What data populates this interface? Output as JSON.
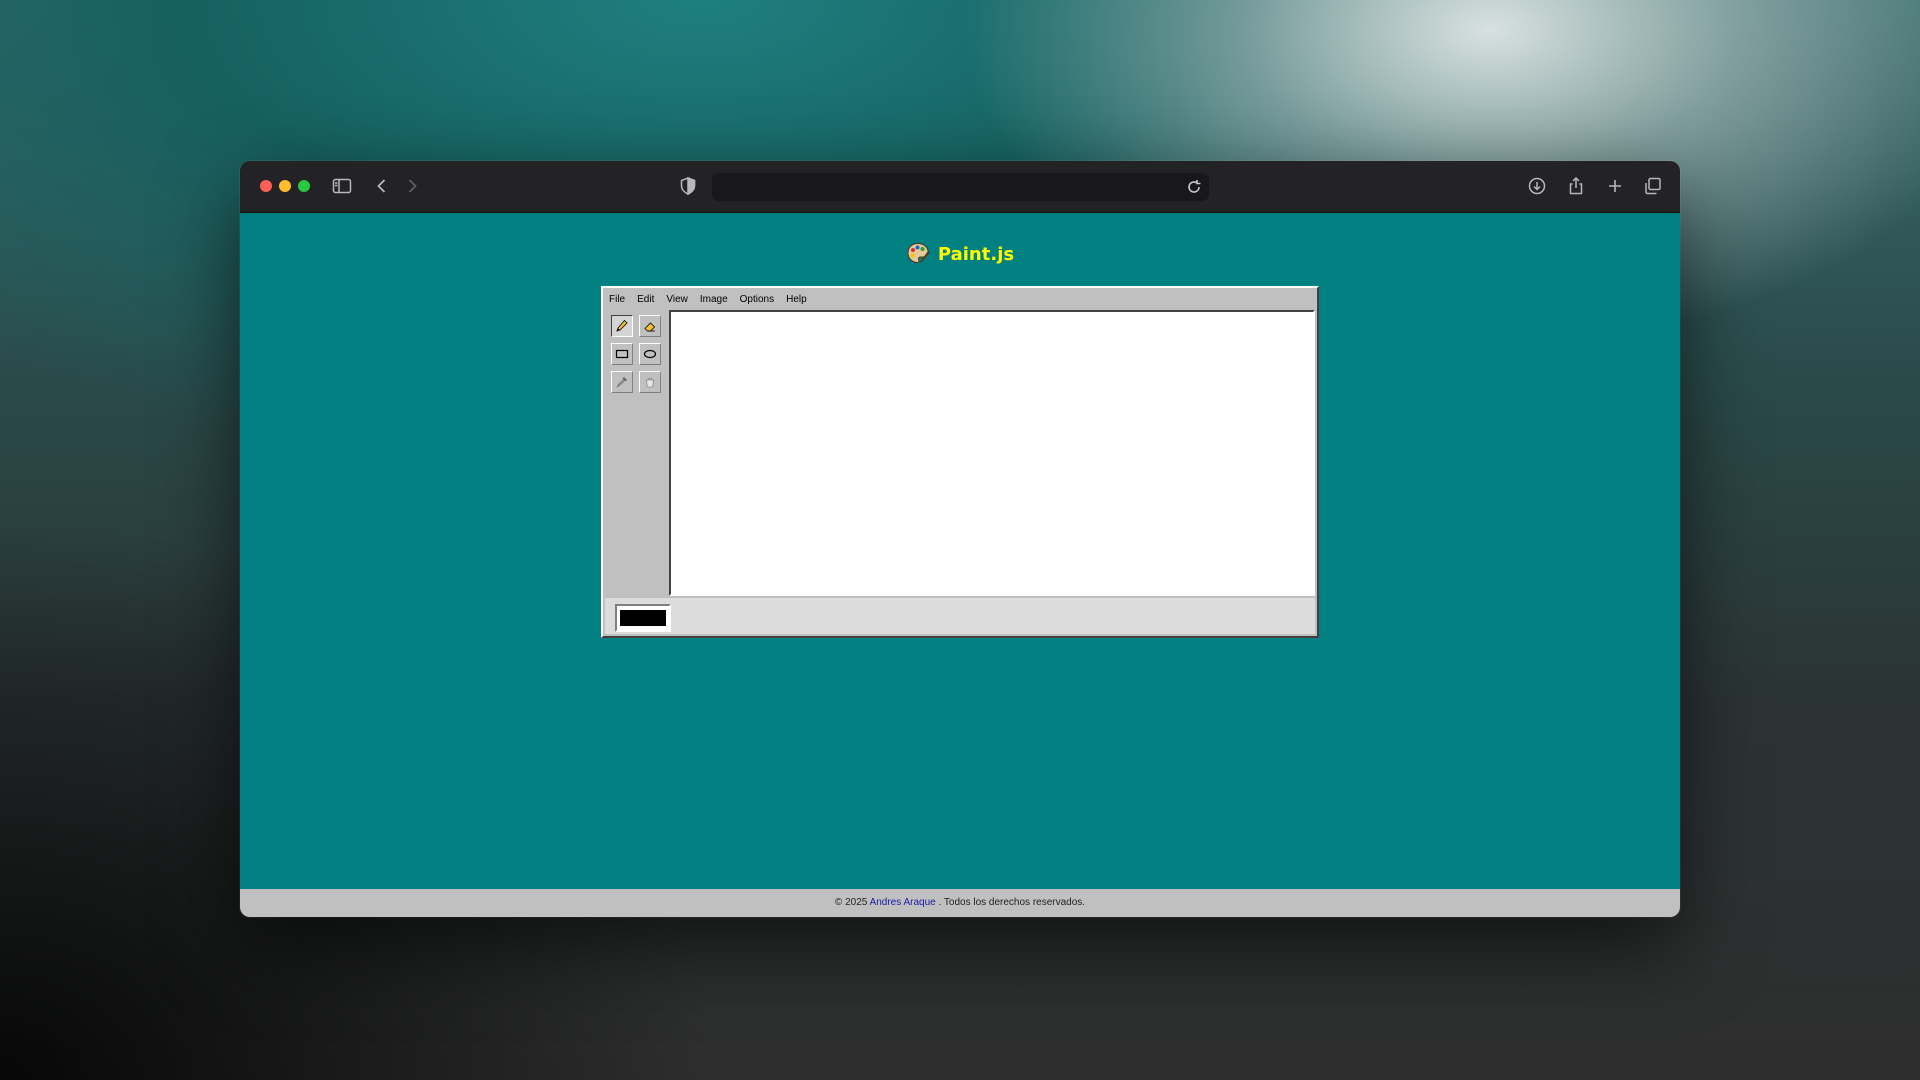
{
  "app": {
    "title": "Paint.js",
    "icon": "palette-icon"
  },
  "browser": {
    "url": "",
    "icons": [
      "sidebar-icon",
      "back-icon",
      "forward-icon",
      "shield-icon",
      "reload-icon",
      "download-icon",
      "share-icon",
      "new-tab-icon",
      "tabs-overview-icon"
    ]
  },
  "menu": {
    "items": [
      "File",
      "Edit",
      "View",
      "Image",
      "Options",
      "Help"
    ]
  },
  "tools": [
    {
      "name": "pencil",
      "icon": "pencil-icon",
      "active": true
    },
    {
      "name": "eraser",
      "icon": "eraser-icon",
      "active": false
    },
    {
      "name": "rectangle",
      "icon": "rectangle-icon",
      "active": false
    },
    {
      "name": "ellipse",
      "icon": "ellipse-icon",
      "active": false
    },
    {
      "name": "color-picker",
      "icon": "eyedropper-icon",
      "active": false
    },
    {
      "name": "fill",
      "icon": "bucket-icon",
      "active": false
    }
  ],
  "colors": {
    "current": "#000000",
    "background": "#008080",
    "title": "#ffff00"
  },
  "footer": {
    "prefix": "© 2025",
    "author": "Andres Araque",
    "suffix": ". Todos los derechos reservados."
  }
}
